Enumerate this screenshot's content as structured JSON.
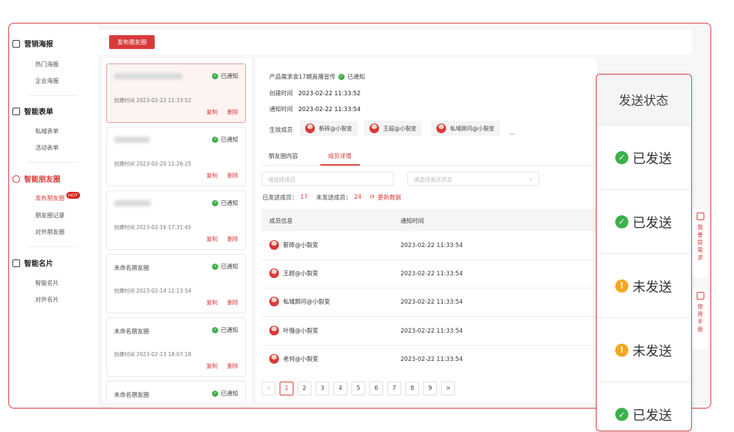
{
  "sidebar": {
    "sections": [
      {
        "title": "营销海报",
        "items": [
          "热门海报",
          "企业海报"
        ]
      },
      {
        "title": "智能表单",
        "items": [
          "私域表单",
          "活动表单"
        ]
      },
      {
        "title": "智能朋友圈",
        "items": [
          "发布朋友圈",
          "朋友圈记录",
          "对外朋友圈"
        ]
      },
      {
        "title": "智能名片",
        "items": [
          "智能名片",
          "对外名片"
        ]
      }
    ],
    "hot_badge": "HOT"
  },
  "toolbar": {
    "publish_label": "发布朋友圈"
  },
  "cards": [
    {
      "title": "",
      "status": "已通知",
      "created": "创建时间  2023-02-22 11:33:52",
      "copy": "复制",
      "delete": "删除"
    },
    {
      "title": "",
      "status": "已通知",
      "created": "创建时间  2023-02-20 11:26:25",
      "copy": "复制",
      "delete": "删除"
    },
    {
      "title": "",
      "status": "已通知",
      "created": "创建时间  2023-02-16 17:31:45",
      "copy": "复制",
      "delete": "删除"
    },
    {
      "title": "未命名朋友圈",
      "status": "已通知",
      "created": "创建时间  2023-02-14 11:13:54",
      "copy": "复制",
      "delete": "删除"
    },
    {
      "title": "未命名朋友圈",
      "status": "已通知",
      "created": "创建时间  2023-02-13 18:07:18",
      "copy": "复制",
      "delete": "删除"
    },
    {
      "title": "未命名朋友圈",
      "status": "已通知"
    }
  ],
  "detail": {
    "title": "产品需求会17期直播宣传",
    "status": "已通知",
    "created_label": "创建时间",
    "created": "2023-02-22 11:33:52",
    "notify_label": "通知时间",
    "notified": "2023-02-22 11:33:54",
    "members_label": "生效成员",
    "members": [
      "靳砖@小裂变",
      "王超@小裂变",
      "私域顾问@小裂变"
    ],
    "more": "..."
  },
  "tabs": [
    "朋友圈内容",
    "成员详情"
  ],
  "filters": {
    "member_placeholder": "请选择成员",
    "status_placeholder": "请选择发送状态"
  },
  "stats": {
    "sent_label": "已发送成员：",
    "sent": "17",
    "unsent_label": "未发送成员：",
    "unsent": "24",
    "refresh": "更新数据"
  },
  "table": {
    "headers": [
      "成员信息",
      "通知时间"
    ],
    "rows": [
      {
        "name": "靳砖@小裂变",
        "time": "2023-02-22 11:33:54"
      },
      {
        "name": "王超@小裂变",
        "time": "2023-02-22 11:33:54"
      },
      {
        "name": "私域顾问@小裂变",
        "time": "2023-02-22 11:33:54"
      },
      {
        "name": "叶强@小裂变",
        "time": "2023-02-22 11:33:54"
      },
      {
        "name": "老何@小裂变",
        "time": "2023-02-22 11:33:54"
      }
    ]
  },
  "pager": {
    "prev": "<",
    "pages": [
      "1",
      "2",
      "3",
      "4",
      "5",
      "6",
      "7",
      "8",
      "9"
    ],
    "next": ">"
  },
  "send_status": {
    "header": "发送状态",
    "rows": [
      {
        "label": "已发送",
        "state": "sent"
      },
      {
        "label": "已发送",
        "state": "sent"
      },
      {
        "label": "未发送",
        "state": "unsent"
      },
      {
        "label": "未发送",
        "state": "unsent"
      },
      {
        "label": "已发送",
        "state": "sent"
      }
    ]
  },
  "float_tools": [
    {
      "label": "我要提需求",
      "icon": "edit-icon"
    },
    {
      "label": "使用手册",
      "icon": "book-icon"
    }
  ],
  "colors": {
    "accent": "#d83a3a",
    "ok": "#3cb04a",
    "warn": "#f5a623"
  }
}
